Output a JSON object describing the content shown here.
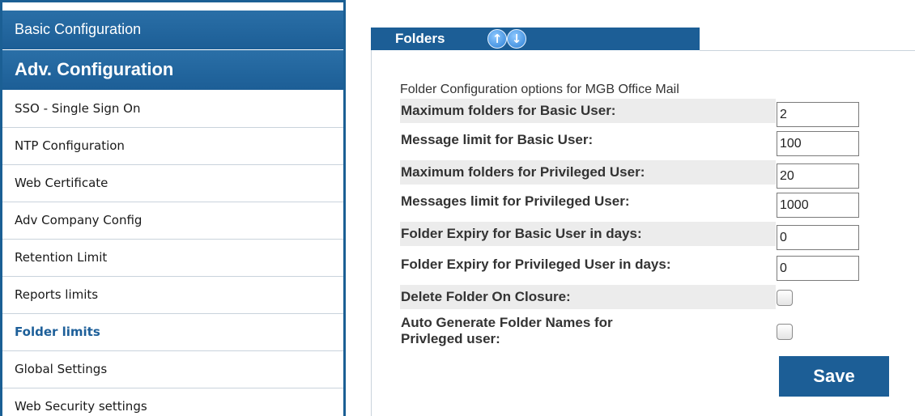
{
  "sidebar": {
    "header_basic": "Basic Configuration",
    "header_adv": "Adv. Configuration",
    "items": [
      {
        "label": "SSO - Single Sign On"
      },
      {
        "label": "NTP Configuration"
      },
      {
        "label": "Web Certificate"
      },
      {
        "label": "Adv Company Config"
      },
      {
        "label": "Retention Limit"
      },
      {
        "label": "Reports limits"
      },
      {
        "label": "Folder limits"
      },
      {
        "label": "Global Settings"
      },
      {
        "label": "Web Security settings"
      }
    ],
    "active_item": "Folder limits"
  },
  "panel": {
    "title": "Folders",
    "arrow_up": "↑",
    "arrow_down": "↓",
    "intro": "Folder Configuration options for MGB Office Mail",
    "fields": [
      {
        "label": "Maximum folders for Basic User:",
        "value": "2"
      },
      {
        "label": "Message limit for Basic User:",
        "value": "100"
      },
      {
        "label": "Maximum folders for Privileged User:",
        "value": "20"
      },
      {
        "label": "Messages limit for Privileged User:",
        "value": "1000"
      },
      {
        "label": "Folder Expiry for Basic User in days:",
        "value": "0"
      },
      {
        "label": "Folder Expiry for Privileged User in days:",
        "value": "0"
      }
    ],
    "checkboxes": [
      {
        "label": "Delete Folder On Closure:",
        "checked": false
      },
      {
        "label_line1": "Auto Generate Folder Names for",
        "label_line2": "Privleged user:",
        "checked": false
      }
    ],
    "save_label": "Save"
  },
  "colors": {
    "brand_blue": "#1c5e96",
    "row_shade": "#ececec"
  }
}
